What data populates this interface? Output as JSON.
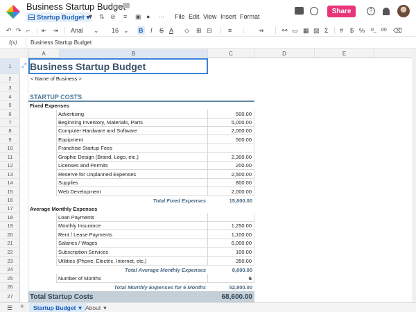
{
  "title": {
    "doc_name": "Business Startup Budget",
    "sheet_name": "Startup Budget"
  },
  "menu": [
    "File",
    "Edit",
    "View",
    "Insert",
    "Format"
  ],
  "share_label": "Share",
  "toolbar": {
    "font": "Arial",
    "size": "16",
    "bold": "B",
    "italic": "I",
    "strike": "S",
    "text_color": "A",
    "currency": "$",
    "percent": "%",
    "decimals": ".0_",
    "decimals2": ".00"
  },
  "formula": {
    "fx": "f(x)",
    "value": "Business Startup Budget"
  },
  "columns": [
    "A",
    "B",
    "C",
    "D",
    "E"
  ],
  "rows": [
    "1",
    "2",
    "3",
    "4",
    "5",
    "6",
    "7",
    "8",
    "9",
    "10",
    "11",
    "12",
    "13",
    "14",
    "15",
    "16",
    "17",
    "18",
    "19",
    "20",
    "21",
    "22",
    "23",
    "24",
    "25",
    "26",
    "27"
  ],
  "sheet": {
    "title": "Business Startup Budget",
    "subtitle": "< Name of Business >",
    "section": "STARTUP COSTS",
    "fixed_header": "Fixed Expenses",
    "fixed_items": [
      {
        "label": "Advertising",
        "value": "500.00"
      },
      {
        "label": "Beginning Inventory, Materials, Parts",
        "value": "5,000.00"
      },
      {
        "label": "Computer Hardware and Software",
        "value": "2,000.00"
      },
      {
        "label": "Equipment",
        "value": "500.00"
      },
      {
        "label": "Franchise Startup Fees",
        "value": ""
      },
      {
        "label": "Graphic Design (Brand, Logo, etc.)",
        "value": "2,300.00"
      },
      {
        "label": "Licenses and Permits",
        "value": "200.00"
      },
      {
        "label": "Reserve for Unplanned Expenses",
        "value": "2,500.00"
      },
      {
        "label": "Supplies",
        "value": "800.00"
      },
      {
        "label": "Web Development",
        "value": "2,000.00"
      }
    ],
    "fixed_total_label": "Total Fixed Expenses",
    "fixed_total_value": "15,800.00",
    "monthly_header": "Average Monthly Expenses",
    "monthly_items": [
      {
        "label": "Loan Payments",
        "value": ""
      },
      {
        "label": "Monthly Insurance",
        "value": "1,250.00"
      },
      {
        "label": "Rent / Lease Payments",
        "value": "1,100.00"
      },
      {
        "label": "Salaries / Wages",
        "value": "6,000.00"
      },
      {
        "label": "Subscription Services",
        "value": "100.00"
      },
      {
        "label": "Utilities (Phone, Electric, Internet, etc.)",
        "value": "350.00"
      }
    ],
    "monthly_total_label": "Total Average Monthly Expenses",
    "monthly_total_value": "8,800.00",
    "months_label": "Number of Months",
    "months_value": "6",
    "monthly_expenses_label": "Total Monthly Expenses for 6 Months",
    "monthly_expenses_value": "52,800.00",
    "grand_label": "Total Startup Costs",
    "grand_value": "68,600.00"
  },
  "tabs": [
    {
      "label": "Startup Budget",
      "active": true
    },
    {
      "label": "About",
      "active": false
    }
  ],
  "colors": {
    "accent": "#1a5fb4",
    "share": "#e8347a",
    "section": "#4a7a9a",
    "total": "#4a6b86",
    "grand_bg": "#c4cfd8"
  }
}
